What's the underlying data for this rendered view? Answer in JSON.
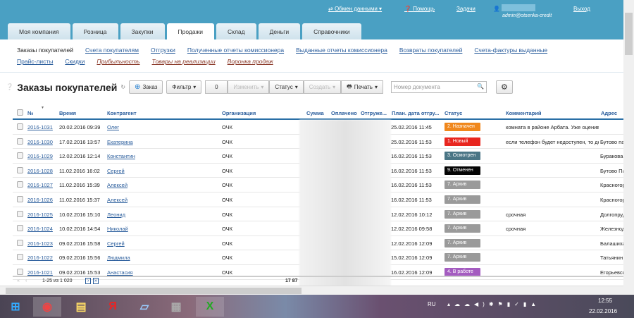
{
  "header": {
    "exchange": "Обмен данными",
    "help": "Помощь",
    "tasks": "Задачи",
    "user_email": "admin@otsenka-credit",
    "logout": "Выход"
  },
  "tabs": [
    "Моя компания",
    "Розница",
    "Закупки",
    "Продажи",
    "Склад",
    "Деньги",
    "Справочники"
  ],
  "subnav": {
    "row1": [
      "Заказы покупателей",
      "Счета покупателям",
      "Отгрузки",
      "Полученные отчеты комиссионера",
      "Выданные отчеты комиссионера",
      "Возвраты покупателей",
      "Счета-фактуры выданные"
    ],
    "row2": [
      "Прайс-листы",
      "Скидки"
    ],
    "row2_special": [
      "Прибыльность",
      "Товары на реализации",
      "Воронка продаж"
    ]
  },
  "toolbar": {
    "title": "Заказы покупателей",
    "order": "Заказ",
    "filter": "Фильтр",
    "count": "0",
    "edit": "Изменить",
    "status": "Статус",
    "create": "Создать",
    "print": "Печать",
    "search_placeholder": "Номер документа"
  },
  "columns": [
    "№",
    "Время",
    "Контрагент",
    "Организация",
    "Сумма",
    "Оплачено",
    "Отгруже...",
    "План. дата отгру...",
    "Статус",
    "Комментарий",
    "Адрес"
  ],
  "rows": [
    {
      "num": "2016-1031",
      "time": "20.02.2016 09:39",
      "client": "Олег",
      "org": "ОЧК",
      "plan": "25.02.2016 11:45",
      "status": "2. Назначен",
      "color": "#f0871c",
      "comment": "комната в районе Арбата. Уже оценива.",
      "address": ""
    },
    {
      "num": "2016-1030",
      "time": "17.02.2016 13:57",
      "client": "Екатерина",
      "org": "ОЧК",
      "plan": "25.02.2016 11:53",
      "status": "1. Новый",
      "color": "#e8261f",
      "comment": "если телефон будет недоступен, то допо",
      "address": "Бутово пар"
    },
    {
      "num": "2016-1029",
      "time": "12.02.2016 12:14",
      "client": "Константин",
      "org": "ОЧК",
      "plan": "16.02.2016 11:53",
      "status": "3. Осмотрен",
      "color": "#4a7585",
      "comment": "",
      "address": "Буракова,"
    },
    {
      "num": "2016-1028",
      "time": "11.02.2016 16:02",
      "client": "Сергей",
      "org": "ОЧК",
      "plan": "16.02.2016 11:53",
      "status": "9. Отменен",
      "color": "#050505",
      "comment": "",
      "address": "Бутово Па"
    },
    {
      "num": "2016-1027",
      "time": "11.02.2016 15:39",
      "client": "Алексей",
      "org": "ОЧК",
      "plan": "16.02.2016 11:53",
      "status": "7. Архив",
      "color": "#9a9a9a",
      "comment": "",
      "address": "Красногор"
    },
    {
      "num": "2016-1026",
      "time": "11.02.2016 15:37",
      "client": "Алексей",
      "org": "ОЧК",
      "plan": "16.02.2016 11:53",
      "status": "7. Архив",
      "color": "#9a9a9a",
      "comment": "",
      "address": "Красногор"
    },
    {
      "num": "2016-1025",
      "time": "10.02.2016 15:10",
      "client": "Леонид",
      "org": "ОЧК",
      "plan": "12.02.2016 10:12",
      "status": "7. Архив",
      "color": "#9a9a9a",
      "comment": "срочная",
      "address": "Долгопруд"
    },
    {
      "num": "2016-1024",
      "time": "10.02.2016 14:54",
      "client": "Николай",
      "org": "ОЧК",
      "plan": "12.02.2016 09:58",
      "status": "7. Архив",
      "color": "#9a9a9a",
      "comment": "срочная",
      "address": "Железнод"
    },
    {
      "num": "2016-1023",
      "time": "09.02.2016 15:58",
      "client": "Сергей",
      "org": "ОЧК",
      "plan": "12.02.2016 12:09",
      "status": "7. Архив",
      "color": "#9a9a9a",
      "comment": "",
      "address": "Балашиха,"
    },
    {
      "num": "2016-1022",
      "time": "09.02.2016 15:56",
      "client": "Людмила",
      "org": "ОЧК",
      "plan": "15.02.2016 12:09",
      "status": "7. Архив",
      "color": "#9a9a9a",
      "comment": "",
      "address": "Татьянин"
    },
    {
      "num": "2016-1021",
      "time": "09.02.2016 15:53",
      "client": "Анастасия",
      "org": "ОЧК",
      "plan": "16.02.2016 12:09",
      "status": "4. В работе",
      "color": "#a45cc0",
      "comment": "",
      "address": "Егорьевск"
    }
  ],
  "footer": {
    "range": "1-25 из 1 020",
    "total": "17 87"
  },
  "taskbar": {
    "lang": "RU",
    "time": "12:55",
    "date": "22.02.2016"
  }
}
